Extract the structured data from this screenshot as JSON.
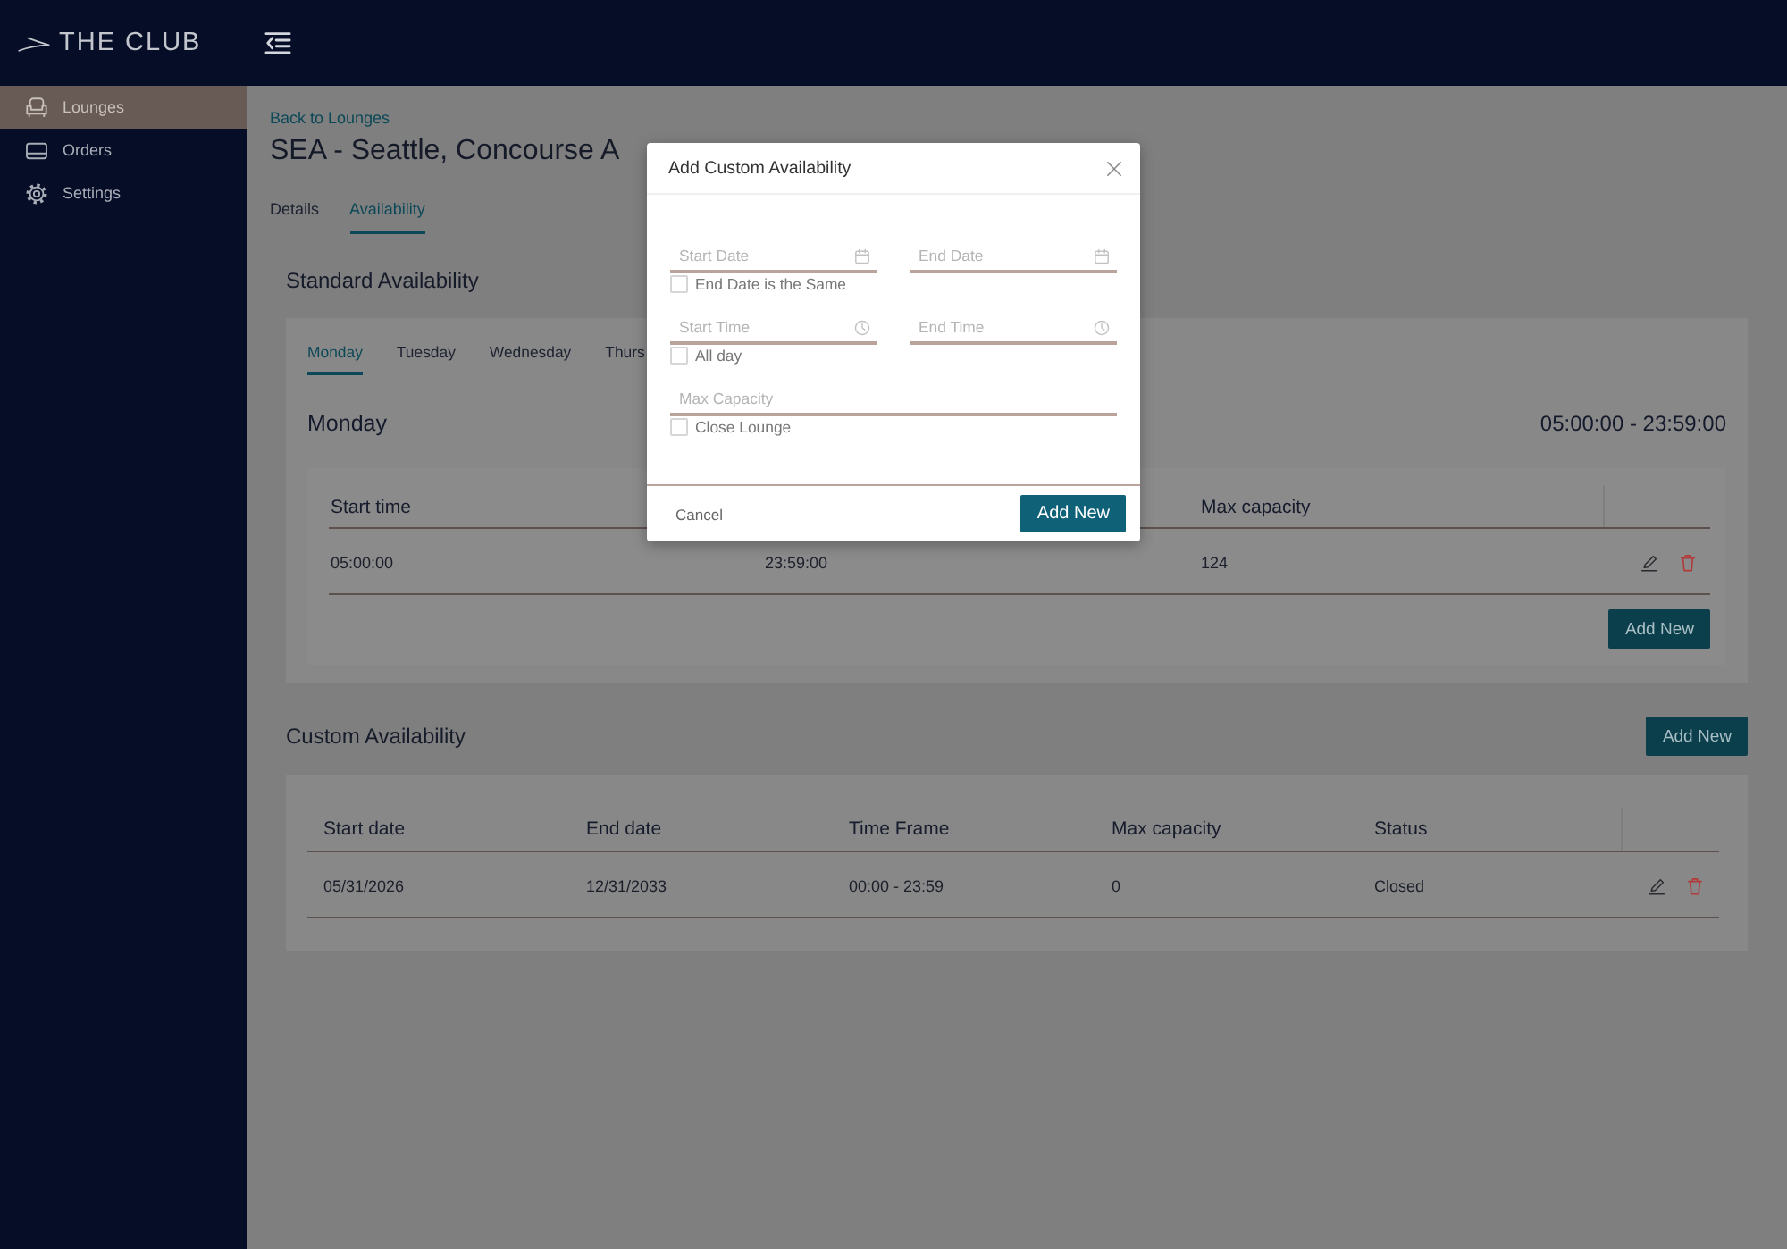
{
  "header": {
    "logo_text": "THE CLUB"
  },
  "sidebar": {
    "items": [
      {
        "label": "Lounges",
        "selected": true
      },
      {
        "label": "Orders",
        "selected": false
      },
      {
        "label": "Settings",
        "selected": false
      }
    ]
  },
  "page": {
    "back_link": "Back to Lounges",
    "title": "SEA - Seattle, Concourse A",
    "tabs": [
      {
        "label": "Details",
        "selected": false
      },
      {
        "label": "Availability",
        "selected": true
      }
    ]
  },
  "standard_availability": {
    "title": "Standard Availability",
    "day_tabs": [
      {
        "label": "Monday",
        "selected": true
      },
      {
        "label": "Tuesday",
        "selected": false
      },
      {
        "label": "Wednesday",
        "selected": false
      },
      {
        "label": "Thurs",
        "selected": false
      }
    ],
    "day_title": "Monday",
    "day_hours": "05:00:00 - 23:59:00",
    "table": {
      "columns": [
        "Start time",
        null,
        "Max capacity"
      ],
      "rows": [
        {
          "cells": [
            "05:00:00",
            "23:59:00",
            "124"
          ]
        }
      ]
    },
    "add_button": "Add New"
  },
  "custom_availability": {
    "title": "Custom Availability",
    "add_button": "Add New",
    "table": {
      "columns": [
        "Start date",
        "End date",
        "Time Frame",
        "Max capacity",
        "Status"
      ],
      "rows": [
        {
          "cells": [
            "05/31/2026",
            "12/31/2033",
            "00:00 - 23:59",
            "0",
            "Closed"
          ]
        }
      ]
    }
  },
  "modal": {
    "title": "Add Custom Availability",
    "fields": [
      {
        "kind": "date",
        "placeholder": "Start Date"
      },
      {
        "kind": "date",
        "placeholder": "End Date"
      },
      {
        "kind": "checkbox",
        "label": "End Date is the Same",
        "checked": false
      },
      {
        "kind": "time",
        "placeholder": "Start Time"
      },
      {
        "kind": "time",
        "placeholder": "End Time"
      },
      {
        "kind": "checkbox",
        "label": "All day",
        "checked": false
      },
      {
        "kind": "number",
        "placeholder": "Max Capacity"
      },
      {
        "kind": "checkbox",
        "label": "Close Lounge",
        "checked": false
      }
    ],
    "cancel_button": "Cancel",
    "submit_button": "Add New"
  }
}
